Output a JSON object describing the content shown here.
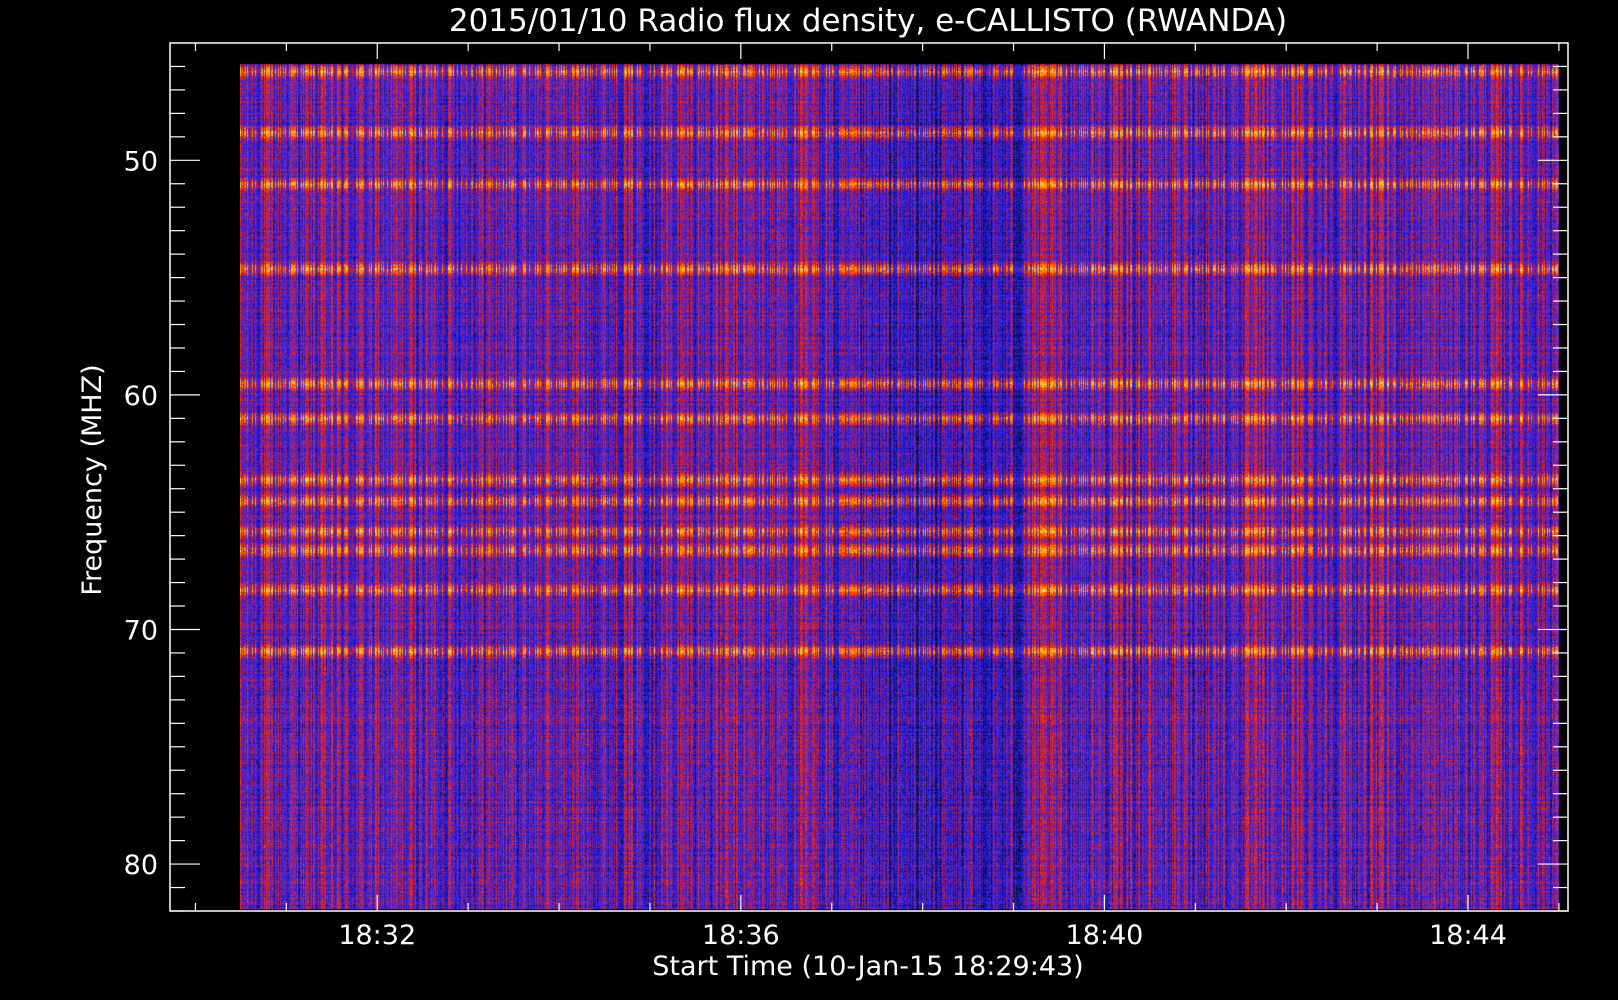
{
  "chart_data": {
    "type": "heatmap",
    "title": "2015/01/10  Radio flux density, e-CALLISTO (RWANDA)",
    "xlabel": "Start Time (10-Jan-15 18:29:43)",
    "ylabel": "Frequency (MHZ)",
    "x_ticks": [
      "18:32",
      "18:36",
      "18:40",
      "18:44"
    ],
    "x_tick_minutes": [
      32,
      36,
      40,
      44
    ],
    "x_range_minutes": [
      29.72,
      45.1
    ],
    "data_time_range_minutes": [
      30.49,
      45.0
    ],
    "y_ticks": [
      "50",
      "60",
      "70",
      "80"
    ],
    "y_tick_values": [
      50,
      60,
      70,
      80
    ],
    "y_range": [
      45.0,
      82.0
    ],
    "data_freq_range": [
      45.9,
      81.9
    ],
    "y_reversed": true,
    "colormap": [
      "#000000",
      "#2222ff",
      "#ff2200",
      "#ffaa00",
      "#ffffaa"
    ],
    "bright_bands_mhz": [
      46.2,
      48.8,
      51.0,
      54.6,
      59.5,
      61.0,
      63.6,
      64.5,
      65.8,
      66.6,
      68.3,
      70.9
    ],
    "quiet_segment_minutes": [
      37.0,
      39.1
    ],
    "grid": false
  }
}
